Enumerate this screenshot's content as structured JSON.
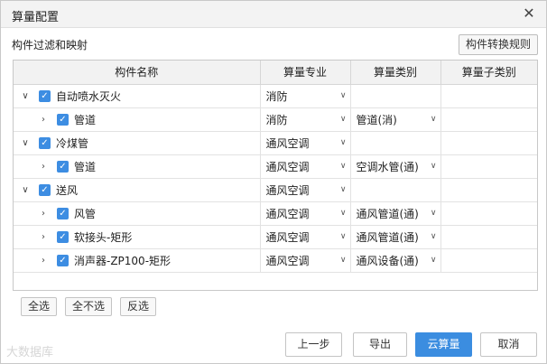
{
  "window": {
    "title": "算量配置"
  },
  "section": {
    "title": "构件过滤和映射",
    "rule_button": "构件转换规则"
  },
  "table": {
    "headers": [
      "构件名称",
      "算量专业",
      "算量类别",
      "算量子类别"
    ],
    "rows": [
      {
        "level": 0,
        "expand": "∨",
        "checked": true,
        "name": "自动喷水灭火",
        "major": "消防",
        "category": "",
        "subcategory": ""
      },
      {
        "level": 1,
        "expand": "›",
        "checked": true,
        "name": "管道",
        "major": "消防",
        "category": "管道(消)",
        "subcategory": ""
      },
      {
        "level": 0,
        "expand": "∨",
        "checked": true,
        "name": "冷煤管",
        "major": "通风空调",
        "category": "",
        "subcategory": ""
      },
      {
        "level": 1,
        "expand": "›",
        "checked": true,
        "name": "管道",
        "major": "通风空调",
        "category": "空调水管(通)",
        "subcategory": ""
      },
      {
        "level": 0,
        "expand": "∨",
        "checked": true,
        "name": "送风",
        "major": "通风空调",
        "category": "",
        "subcategory": ""
      },
      {
        "level": 1,
        "expand": "›",
        "checked": true,
        "name": "风管",
        "major": "通风空调",
        "category": "通风管道(通)",
        "subcategory": ""
      },
      {
        "level": 1,
        "expand": "›",
        "checked": true,
        "name": "软接头-矩形",
        "major": "通风空调",
        "category": "通风管道(通)",
        "subcategory": ""
      },
      {
        "level": 1,
        "expand": "›",
        "checked": true,
        "name": "消声器-ZP100-矩形",
        "major": "通风空调",
        "category": "通风设备(通)",
        "subcategory": ""
      }
    ]
  },
  "selection_buttons": {
    "select_all": "全选",
    "select_none": "全不选",
    "invert": "反选"
  },
  "actions": {
    "prev": "上一步",
    "export": "导出",
    "cloud": "云算量",
    "cancel": "取消"
  },
  "watermark": "大数据库",
  "colors": {
    "accent": "#3b8de0",
    "header_bg": "#f2f2f2"
  }
}
